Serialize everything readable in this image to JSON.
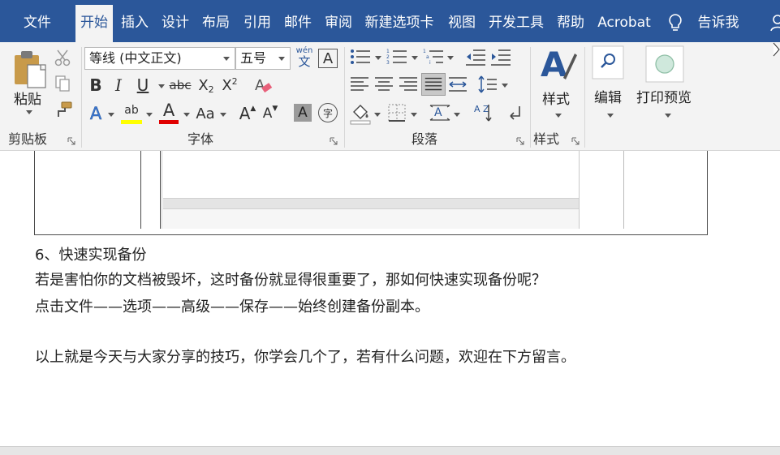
{
  "tabs": [
    {
      "label": "文件",
      "active": false
    },
    {
      "label": "开始",
      "active": true
    },
    {
      "label": "插入",
      "active": false
    },
    {
      "label": "设计",
      "active": false
    },
    {
      "label": "布局",
      "active": false
    },
    {
      "label": "引用",
      "active": false
    },
    {
      "label": "邮件",
      "active": false
    },
    {
      "label": "审阅",
      "active": false
    },
    {
      "label": "新建选项卡",
      "active": false
    },
    {
      "label": "视图",
      "active": false
    },
    {
      "label": "开发工具",
      "active": false
    },
    {
      "label": "帮助",
      "active": false
    },
    {
      "label": "Acrobat",
      "active": false
    }
  ],
  "tell_me": "告诉我",
  "clipboard": {
    "group_label": "剪贴板",
    "paste_label": "粘贴"
  },
  "font": {
    "group_label": "字体",
    "font_name": "等线 (中文正文)",
    "font_size": "五号",
    "wen_top": "wén",
    "wen_bottom": "文",
    "bold": "B",
    "italic": "I",
    "underline": "U",
    "strike": "abc",
    "subscript": "X",
    "subscript_mark": "2",
    "superscript": "X",
    "superscript_mark": "2",
    "text_effect": "A",
    "highlight": "ab",
    "font_color": "A",
    "change_case": "Aa",
    "grow": "A",
    "shrink": "A",
    "char_shading": "A",
    "enclose": "字",
    "border_char": "A",
    "highlight_color": "#ffff00",
    "font_color_bar": "#e00000"
  },
  "paragraph": {
    "group_label": "段落",
    "sort_glyph": "A Z",
    "numbering_marks": [
      "1",
      "2",
      "3"
    ],
    "multilevel_marks": [
      "1",
      "a",
      "i"
    ]
  },
  "styles": {
    "group_label": "样式",
    "styles_label": "样式"
  },
  "editing": {
    "label": "编辑"
  },
  "print_preview": {
    "label": "打印预览"
  },
  "document": {
    "heading": "6、快速实现备份",
    "line1": "若是害怕你的文档被毁坏，这时备份就显得很重要了，那如何快速实现备份呢？",
    "line2": "点击文件——选项——高级——保存——始终创建备份副本。",
    "line3": "以上就是今天与大家分享的技巧，你学会几个了，若有什么问题，欢迎在下方留言。"
  },
  "colors": {
    "brand": "#2b579a",
    "ribbon_bg": "#f3f3f3"
  }
}
